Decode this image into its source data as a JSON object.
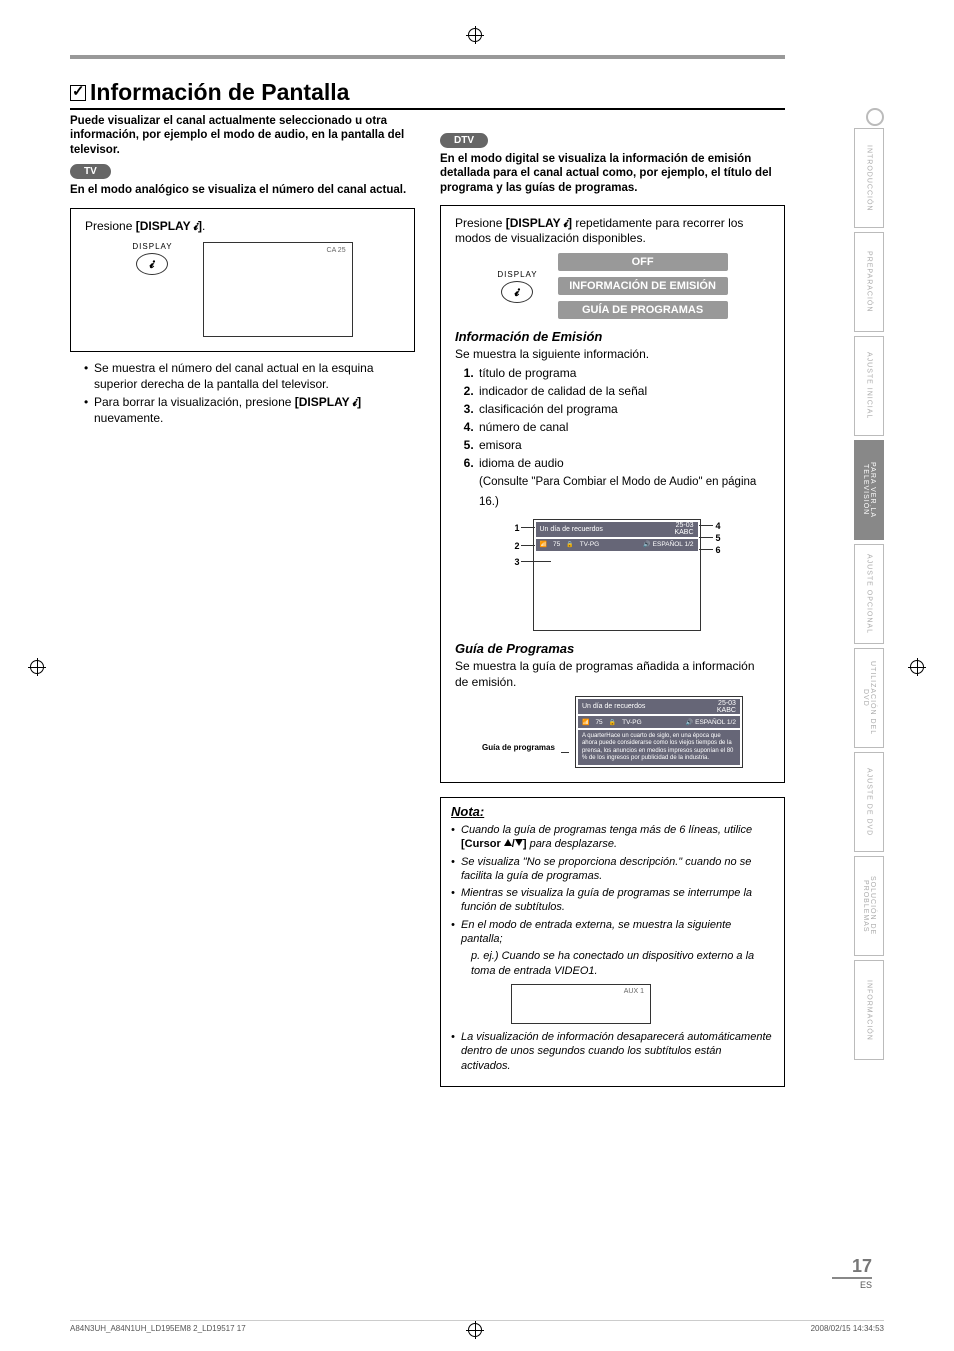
{
  "section": {
    "title": "Información de Pantalla",
    "intro": "Puede visualizar el canal actualmente seleccionado u otra información, por ejemplo el modo de audio, en la pantalla del televisor."
  },
  "tv": {
    "badge": "TV",
    "desc": "En el modo analógico se visualiza el número del canal actual.",
    "step_prefix": "Presione ",
    "step_button": "[DISPLAY 𝓲]",
    "step_suffix": ".",
    "display_label": "DISPLAY",
    "screen_text": "CA 25",
    "bullets": [
      "Se muestra el número del canal actual en la esquina superior derecha de la pantalla del televisor.",
      "Para borrar la visualización, presione [DISPLAY 𝓲] nuevamente."
    ]
  },
  "dtv": {
    "badge": "DTV",
    "desc": "En el modo digital se visualiza la información de emisión detallada para el canal actual como, por ejemplo, el título del programa y las guías de programas.",
    "step_prefix": "Presione ",
    "step_button": "[DISPLAY 𝓲]",
    "step_suffix": " repetidamente para recorrer los modos de visualización disponibles.",
    "display_label": "DISPLAY",
    "modes": {
      "off": "OFF",
      "info": "INFORMACIÓN DE EMISIÓN",
      "guide": "GUÍA DE PROGRAMAS"
    },
    "info_section": {
      "heading": "Información de Emisión",
      "intro": "Se muestra la siguiente información.",
      "items": [
        "título de programa",
        "indicador de calidad de la señal",
        "clasificación del programa",
        "número de canal",
        "emisora",
        "idioma de audio"
      ],
      "audio_ref": "(Consulte \"Para Combiar el Modo de Audio\" en página 16.)",
      "osd": {
        "title": "Un día de recuerdos",
        "channel": "25-03",
        "station": "KABC",
        "signal": "75",
        "rating": "TV-PG",
        "audio": "ESPAÑOL 1/2"
      }
    },
    "guide_section": {
      "heading": "Guía de Programas",
      "intro": "Se muestra la guía de programas añadida a información de emisión.",
      "side_label": "Guía de programas",
      "osd": {
        "title": "Un día de recuerdos",
        "channel": "25-03",
        "station": "KABC",
        "signal": "75",
        "rating": "TV-PG",
        "audio": "ESPAÑOL 1/2",
        "guide_text": "A quarterHace un cuarto de siglo, en una época que ahora puede considerarse como los viejos tiempos de la prensa, los anuncios en medios impresos suponían el 80 % de los ingresos por publicidad de la industria."
      }
    }
  },
  "note": {
    "title": "Nota:",
    "items": [
      "Cuando la guía de programas tenga más de 6 líneas, utilice [Cursor ▲/▼] para desplazarse.",
      "Se visualiza \"No se proporciona descripción.\" cuando no se facilita la guía de programas.",
      "Mientras se visualiza la guía de programas se interrumpe la función de subtítulos.",
      "En el modo de entrada externa, se muestra la siguiente pantalla;"
    ],
    "example_line": "p. ej.) Cuando se ha conectado un dispositivo externo a la toma de entrada VIDEO1.",
    "aux_label": "AUX 1",
    "items_after": [
      "La visualización de información desaparecerá automáticamente dentro de unos segundos cuando los subtítulos están activados."
    ]
  },
  "tabs": [
    {
      "label": "INTRODUCCIÓN",
      "active": false
    },
    {
      "label": "PREPARACIÓN",
      "active": false
    },
    {
      "label": "AJUSTE INICIAL",
      "active": false
    },
    {
      "label": "PARA VER LA TELEVISIÓN",
      "active": true
    },
    {
      "label": "AJUSTE OPCIONAL",
      "active": false
    },
    {
      "label": "UTILIZACIÓN DEL DVD",
      "active": false
    },
    {
      "label": "AJUSTE DE DVD",
      "active": false
    },
    {
      "label": "SOLUCIÓN DE PROBLEMAS",
      "active": false
    },
    {
      "label": "INFORMACIÓN",
      "active": false
    }
  ],
  "page": {
    "number": "17",
    "lang": "ES"
  },
  "footer": {
    "left": "A84N3UH_A84N1UH_LD195EM8 2_LD19517   17",
    "right": "2008/02/15   14:34:53"
  }
}
